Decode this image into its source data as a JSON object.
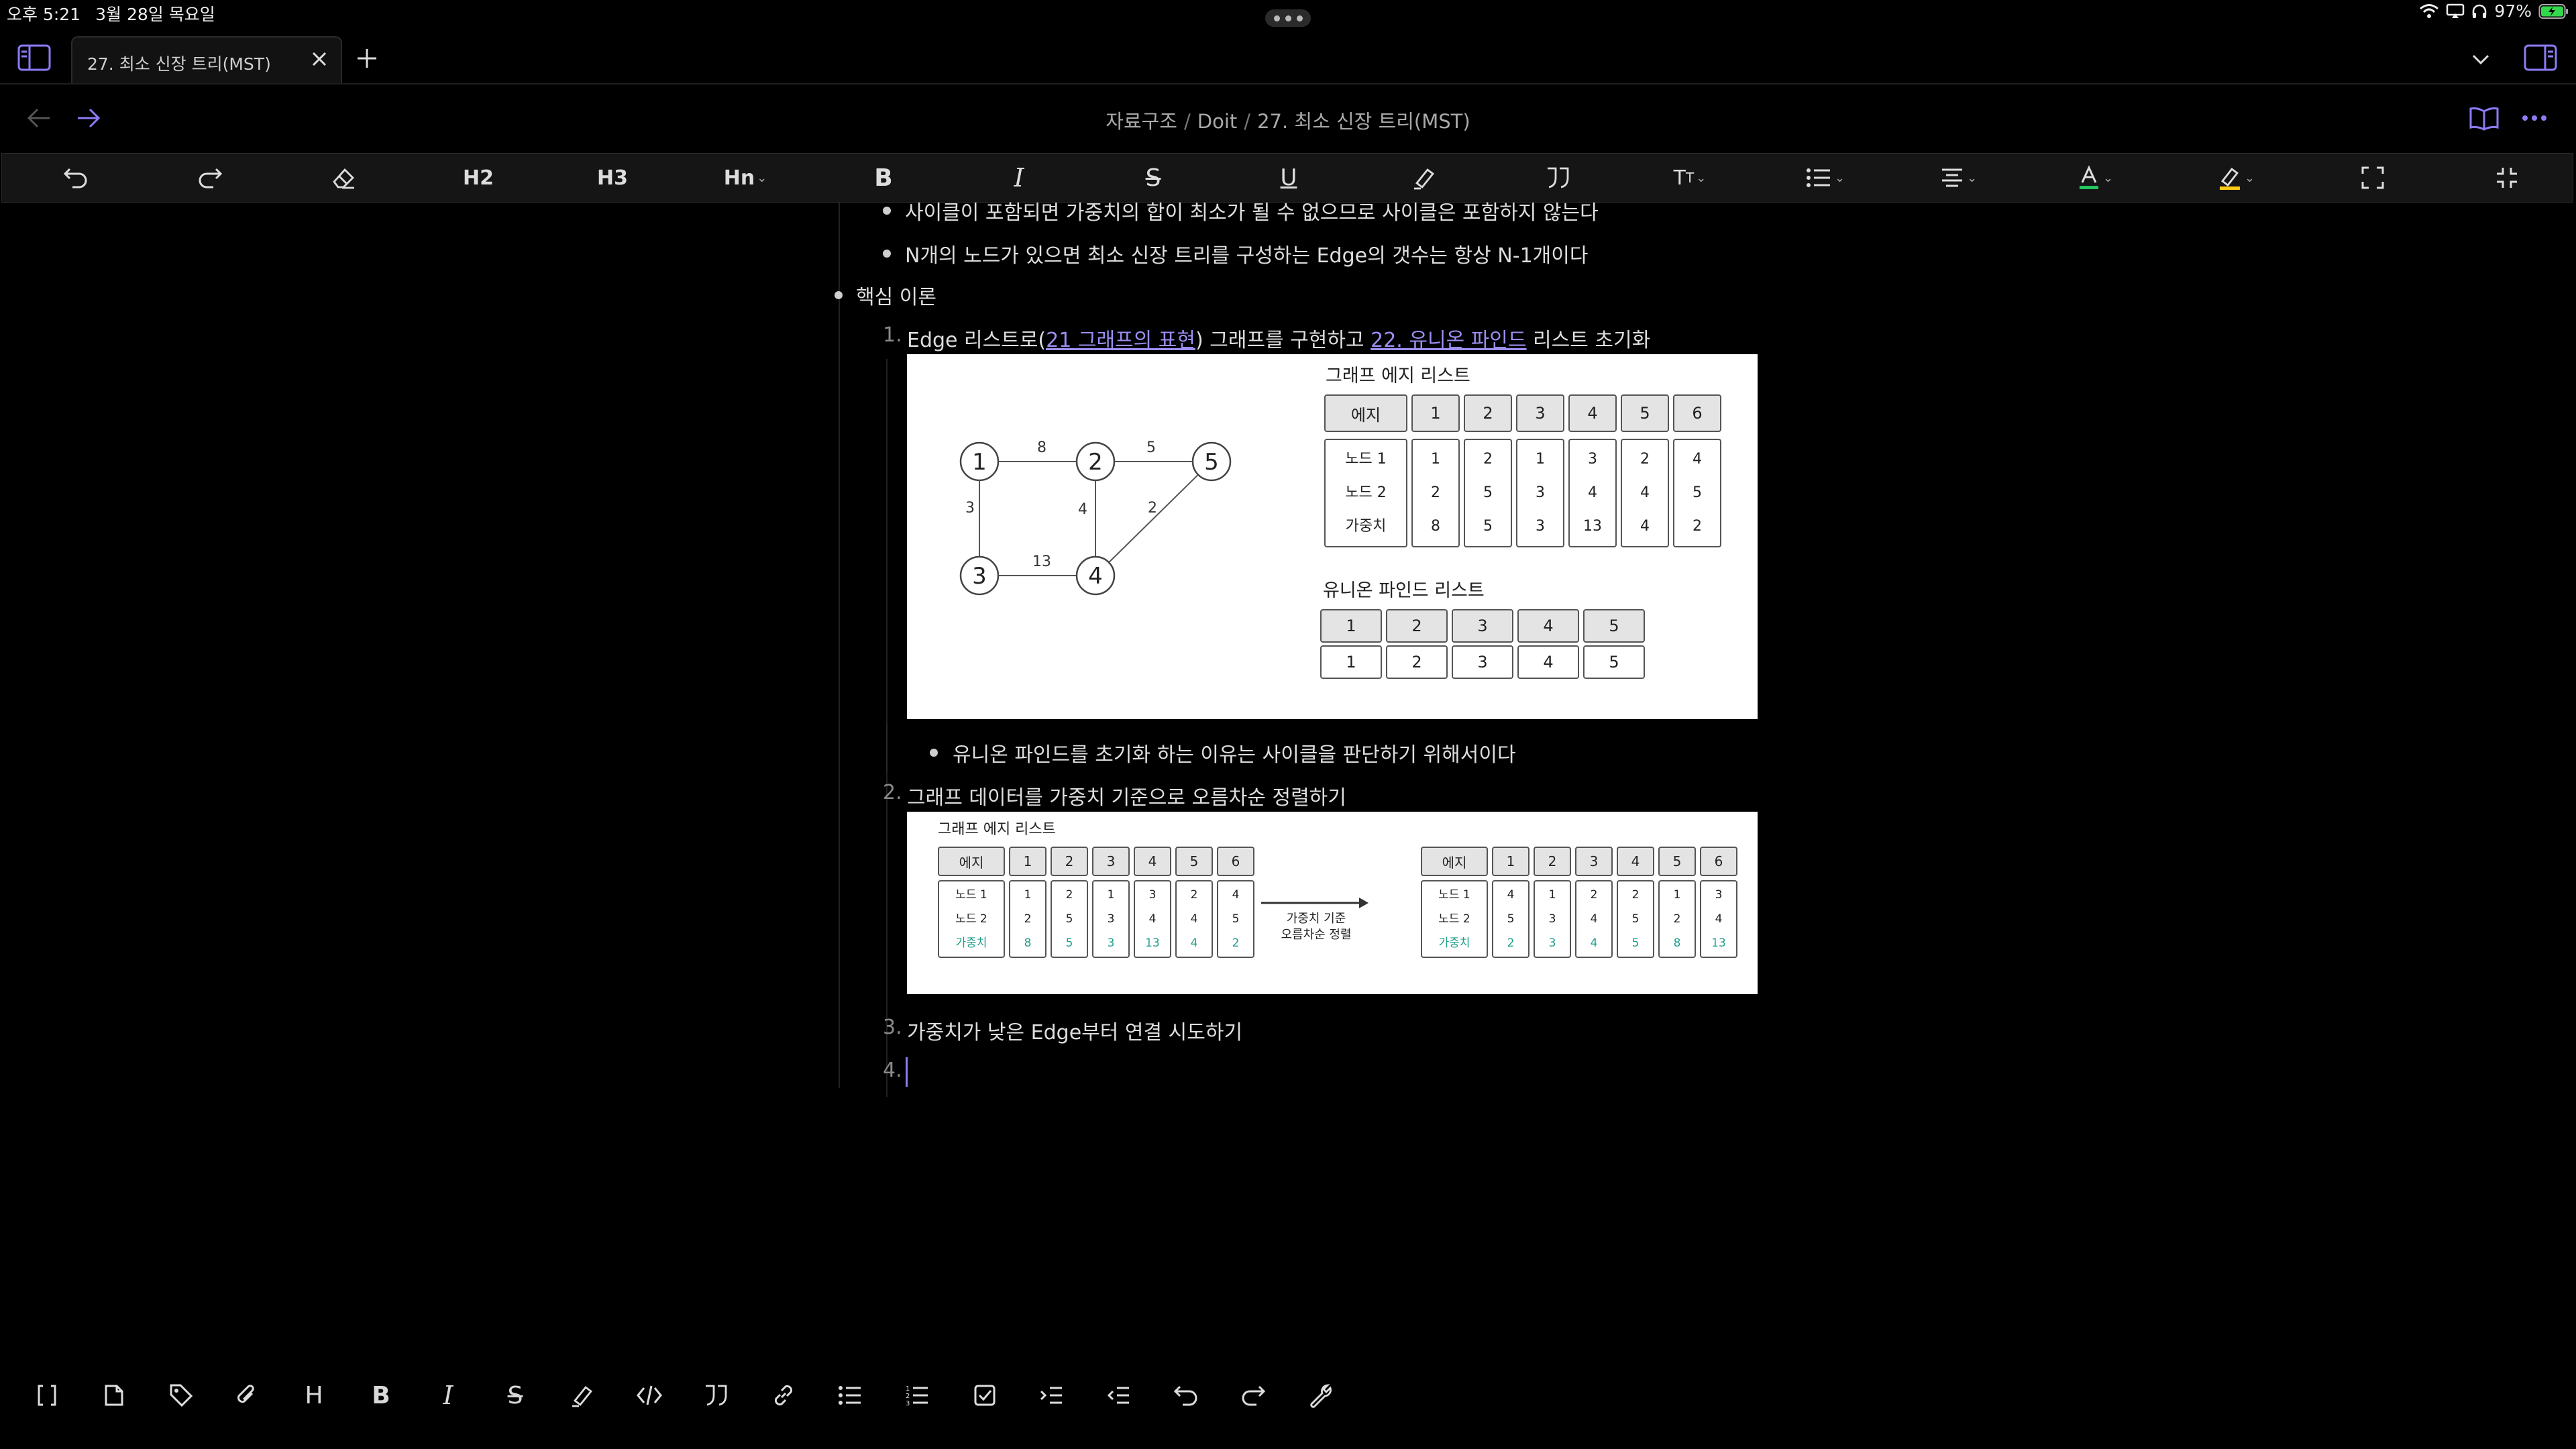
{
  "status": {
    "time": "오후 5:21",
    "date": "3월 28일 목요일",
    "battery": "97%"
  },
  "tab": {
    "title": "27. 최소 신장 트리(MST)"
  },
  "breadcrumb": {
    "part1": "자료구조",
    "part2": "Doit",
    "part3": "27. 최소 신장 트리(MST)"
  },
  "toolbar": {
    "h2": "H2",
    "h3": "H3",
    "hn": "Hn",
    "bold": "B",
    "italic": "I",
    "strike": "S",
    "underline": "U"
  },
  "content": {
    "bullet1": "사이클이 포함되면 가중치의 합이 최소가 될 수 없으므로 사이클은 포함하지 않는다",
    "bullet2": "N개의 노드가 있으면 최소 신장 트리를 구성하는 Edge의 갯수는 항상 N-1개이다",
    "core": "핵심 이론",
    "step1": {
      "num": "1.",
      "pre": "Edge 리스트로(",
      "link1": "21 그래프의 표현",
      "mid": ") 그래프를 구현하고 ",
      "link2": "22. 유니온 파인드",
      "post": " 리스트 초기화"
    },
    "sub_bullet": "유니온 파인드를 초기화 하는 이유는 사이클을 판단하기 위해서이다",
    "step2": {
      "num": "2.",
      "text": "그래프 데이터를 가중치 기준으로 오름차순 정렬하기"
    },
    "step3": {
      "num": "3.",
      "text": "가중치가 낮은 Edge부터 연결 시도하기"
    },
    "step4": {
      "num": "4."
    }
  },
  "figure1": {
    "graph_nodes": [
      "1",
      "2",
      "5",
      "3",
      "4"
    ],
    "graph_weights": [
      "8",
      "5",
      "3",
      "4",
      "2",
      "13"
    ],
    "edge_title": "그래프 에지 리스트",
    "edge_header": "에지",
    "cols": [
      "1",
      "2",
      "3",
      "4",
      "5",
      "6"
    ],
    "row_labels": [
      "노드 1",
      "노드 2",
      "가중치"
    ],
    "rows": [
      [
        "1",
        "2",
        "1",
        "3",
        "2",
        "4"
      ],
      [
        "2",
        "5",
        "3",
        "4",
        "4",
        "5"
      ],
      [
        "8",
        "5",
        "3",
        "13",
        "4",
        "2"
      ]
    ],
    "uf_title": "유니온 파인드 리스트",
    "uf_top": [
      "1",
      "2",
      "3",
      "4",
      "5"
    ],
    "uf_bottom": [
      "1",
      "2",
      "3",
      "4",
      "5"
    ]
  },
  "figure2": {
    "title": "그래프 에지 리스트",
    "header": "에지",
    "cols": [
      "1",
      "2",
      "3",
      "4",
      "5",
      "6"
    ],
    "row_labels": [
      "노드 1",
      "노드 2",
      "가중치"
    ],
    "left_rows": [
      [
        "1",
        "2",
        "1",
        "3",
        "2",
        "4"
      ],
      [
        "2",
        "5",
        "3",
        "4",
        "4",
        "5"
      ],
      [
        "8",
        "5",
        "3",
        "13",
        "4",
        "2"
      ]
    ],
    "right_rows": [
      [
        "4",
        "1",
        "2",
        "2",
        "1",
        "3"
      ],
      [
        "5",
        "3",
        "4",
        "5",
        "2",
        "4"
      ],
      [
        "2",
        "3",
        "4",
        "5",
        "8",
        "13"
      ]
    ],
    "arrow_label1": "가중치 기준",
    "arrow_label2": "오름차순 정렬",
    "weight_color": "#1e9e8a"
  },
  "colors": {
    "accent": "#8b7cf6",
    "link": "#9a8ef0",
    "text_color_underline": "#22c55e",
    "highlight_underline": "#facc15"
  }
}
